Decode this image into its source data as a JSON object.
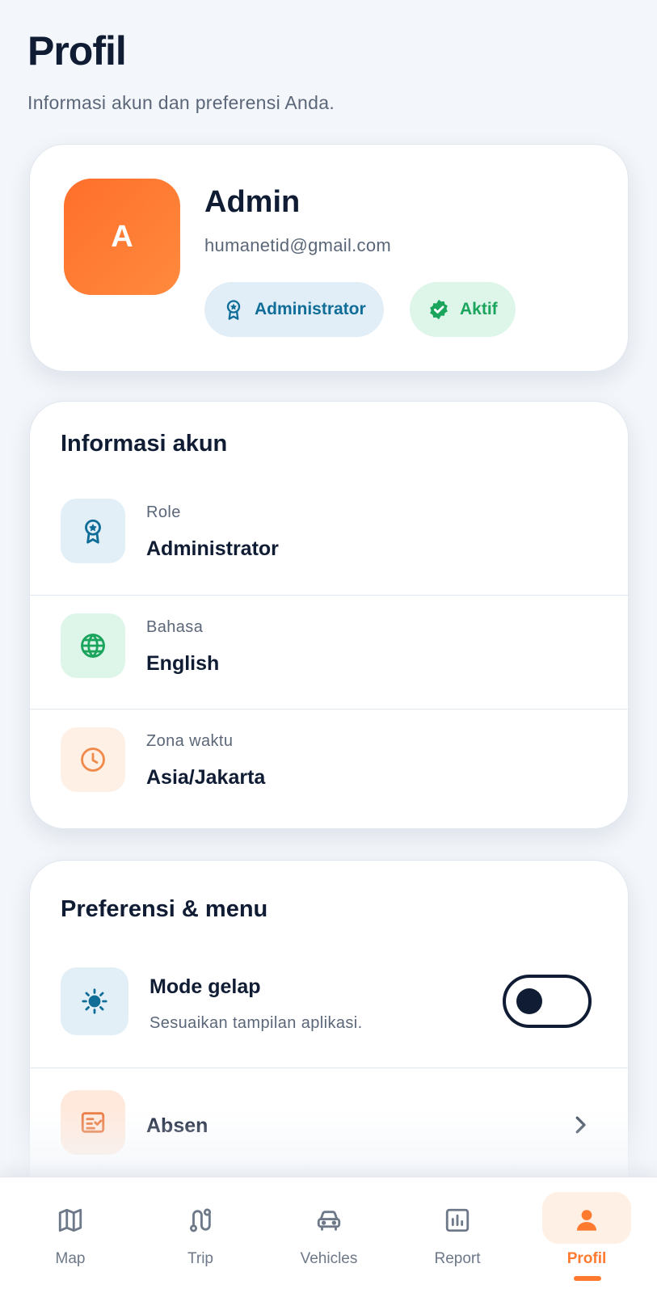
{
  "page": {
    "title": "Profil",
    "subtitle": "Informasi akun dan preferensi Anda."
  },
  "profile": {
    "avatar_initial": "A",
    "name": "Admin",
    "email": "humanetid@gmail.com",
    "role_badge": "Administrator",
    "status_badge": "Aktif",
    "colors": {
      "avatar": "#ff7a33",
      "role_badge_text": "#0f6d98",
      "status_badge_text": "#1aa45c"
    }
  },
  "account_info": {
    "title": "Informasi akun",
    "rows": [
      {
        "icon": "award-icon",
        "label": "Role",
        "value": "Administrator"
      },
      {
        "icon": "globe-icon",
        "label": "Bahasa",
        "value": "English"
      },
      {
        "icon": "clock-icon",
        "label": "Zona waktu",
        "value": "Asia/Jakarta"
      }
    ]
  },
  "preferences": {
    "title": "Preferensi & menu",
    "dark_mode": {
      "icon": "sun-icon",
      "title": "Mode gelap",
      "description": "Sesuaikan tampilan aplikasi.",
      "enabled": false
    },
    "menu": [
      {
        "icon": "checklist-icon",
        "label": "Absen"
      }
    ]
  },
  "nav": {
    "items": [
      {
        "icon": "map-icon",
        "label": "Map",
        "active": false
      },
      {
        "icon": "trip-icon",
        "label": "Trip",
        "active": false
      },
      {
        "icon": "car-icon",
        "label": "Vehicles",
        "active": false
      },
      {
        "icon": "report-icon",
        "label": "Report",
        "active": false
      },
      {
        "icon": "user-icon",
        "label": "Profil",
        "active": true
      }
    ],
    "active_color": "#ff7a2f"
  }
}
